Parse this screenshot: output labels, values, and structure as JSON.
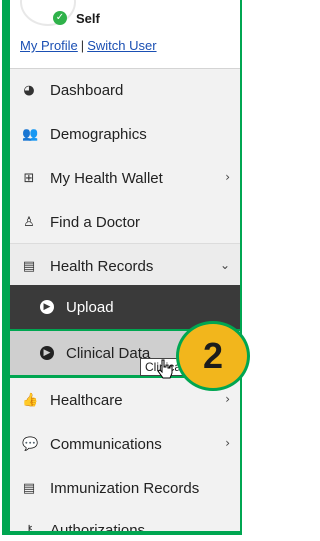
{
  "user": {
    "name": "Self",
    "links": [
      "My Profile",
      "Switch User"
    ],
    "separator": "|"
  },
  "nav": [
    {
      "label": "Dashboard",
      "icon": "dashboard-icon"
    },
    {
      "label": "Demographics",
      "icon": "users-icon"
    },
    {
      "label": "My Health Wallet",
      "icon": "plus-square-icon",
      "has_chevron": true
    },
    {
      "label": "Find a Doctor",
      "icon": "doctor-icon"
    },
    {
      "label": "Health Records",
      "icon": "file-icon",
      "has_chevron": true,
      "expanded": true
    },
    {
      "label": "Upload",
      "icon": "circle-arrow-icon",
      "submenu": true,
      "state": "active"
    },
    {
      "label": "Clinical Data",
      "icon": "circle-arrow-icon",
      "submenu": true,
      "state": "hover"
    },
    {
      "label": "Healthcare",
      "icon": "thumbs-up-icon",
      "has_chevron": true
    },
    {
      "label": "Communications",
      "icon": "comments-icon",
      "has_chevron": true
    },
    {
      "label": "Immunization Records",
      "icon": "file-icon"
    },
    {
      "label": "Authorizations",
      "icon": "key-icon"
    }
  ],
  "tooltip": "Clinical Data",
  "step_badge": "2",
  "colors": {
    "frame": "#00a651",
    "active_bg": "#3a3a3a",
    "hover_bg": "#cfcfcf",
    "badge": "#f2b61c",
    "link": "#1a4fb3"
  }
}
